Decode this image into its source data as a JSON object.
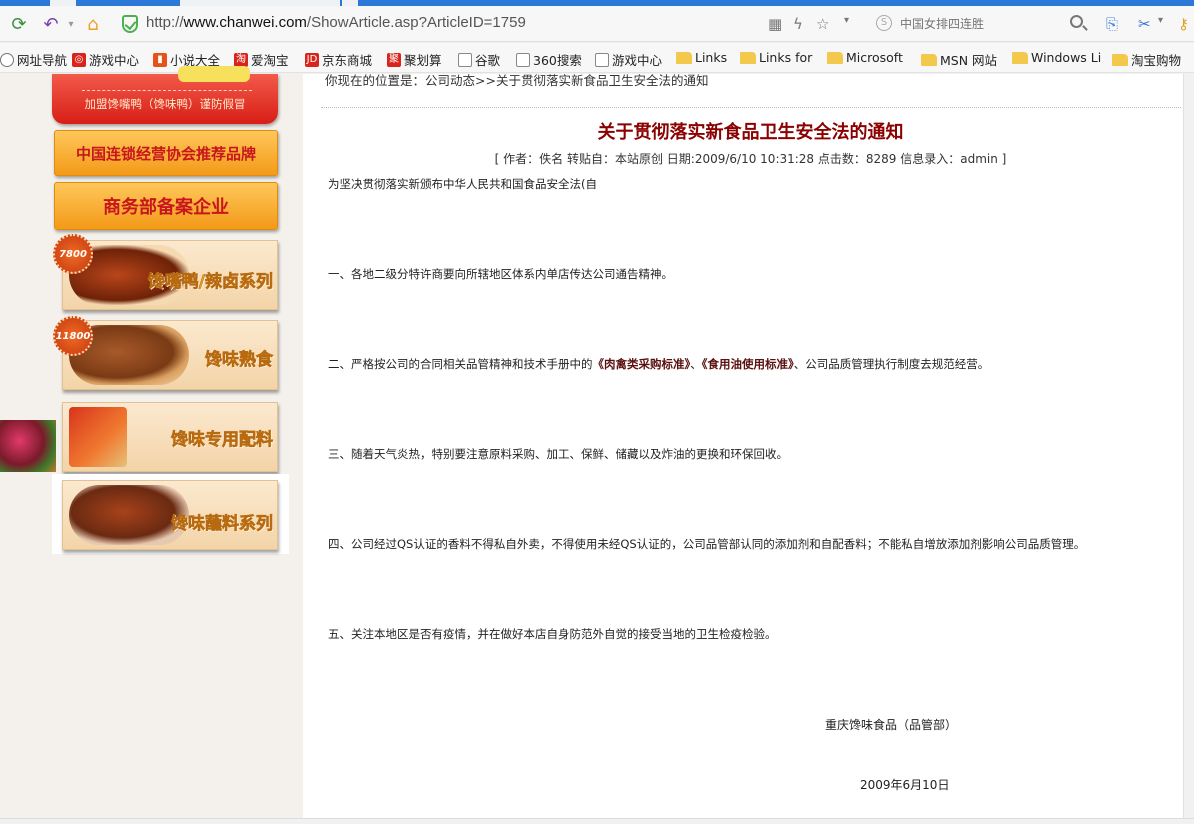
{
  "browser": {
    "url_prefix": "http://",
    "url_domain": "www.chanwei.com",
    "url_path": "/ShowArticle.asp?ArticleID=1759",
    "search_placeholder": "中国女排四连胜",
    "bookmarks": [
      "网址导航",
      "游戏中心",
      "小说大全",
      "爱淘宝",
      "京东商城",
      "聚划算",
      "谷歌",
      "360搜索",
      "游戏中心",
      "Links",
      "Links for",
      "Microsoft",
      "MSN 网站",
      "Windows Li",
      "淘宝购物"
    ]
  },
  "sidebar": {
    "join_sub": "加盟馋嘴鸭（馋味鸭）谨防假冒",
    "banner_brand": "中国连锁经营协会推荐品牌",
    "banner_record": "商务部备案企业",
    "cards": [
      {
        "badge": "7800",
        "label": "馋嘴鸭/辣卤系列"
      },
      {
        "badge": "11800",
        "label": "馋味熟食"
      },
      {
        "badge": "",
        "label": "馋味专用配料"
      },
      {
        "badge": "",
        "label": "馋味蘸料系列"
      }
    ]
  },
  "article": {
    "breadcrumb": "你现在的位置是：公司动态>>关于贯彻落实新食品卫生安全法的通知",
    "title": "关于贯彻落实新食品卫生安全法的通知",
    "meta": "[ 作者：佚名    转贴自：本站原创    日期:2009/6/10 10:31:28 点击数：8289    信息录入：admin ]",
    "intro": "为坚决贯彻落实新颁布中华人民共和国食品安全法(自",
    "p1": "一、各地二级分特许商要向所辖地区体系内单店传达公司通告精神。",
    "p2_a": "二、严格按公司的合同相关品管精神和技术手册中的",
    "p2_b": "《肉禽类采购标准》",
    "p2_c": "、",
    "p2_d": "《食用油使用标准》",
    "p2_e": "、公司品质管理执行制度去规范经营。",
    "p3": "三、随着天气炎热，特别要注意原料采购、加工、保鲜、储藏以及炸油的更换和环保回收。",
    "p4": "四、公司经过QS认证的香料不得私自外卖，不得使用未经QS认证的，公司品管部认同的添加剂和自配香料；不能私自增放添加剂影响公司品质管理。",
    "p5": "五、关注本地区是否有疫情，并在做好本店自身防范外自觉的接受当地的卫生检疫检验。",
    "signature": "重庆馋味食品（品管部）",
    "date": "2009年6月10日"
  },
  "icons": {
    "refresh": "refresh-icon",
    "undo": "undo-icon",
    "home": "home-icon",
    "qr": "qr-icon",
    "bolt": "bolt-icon",
    "star": "star-icon"
  }
}
